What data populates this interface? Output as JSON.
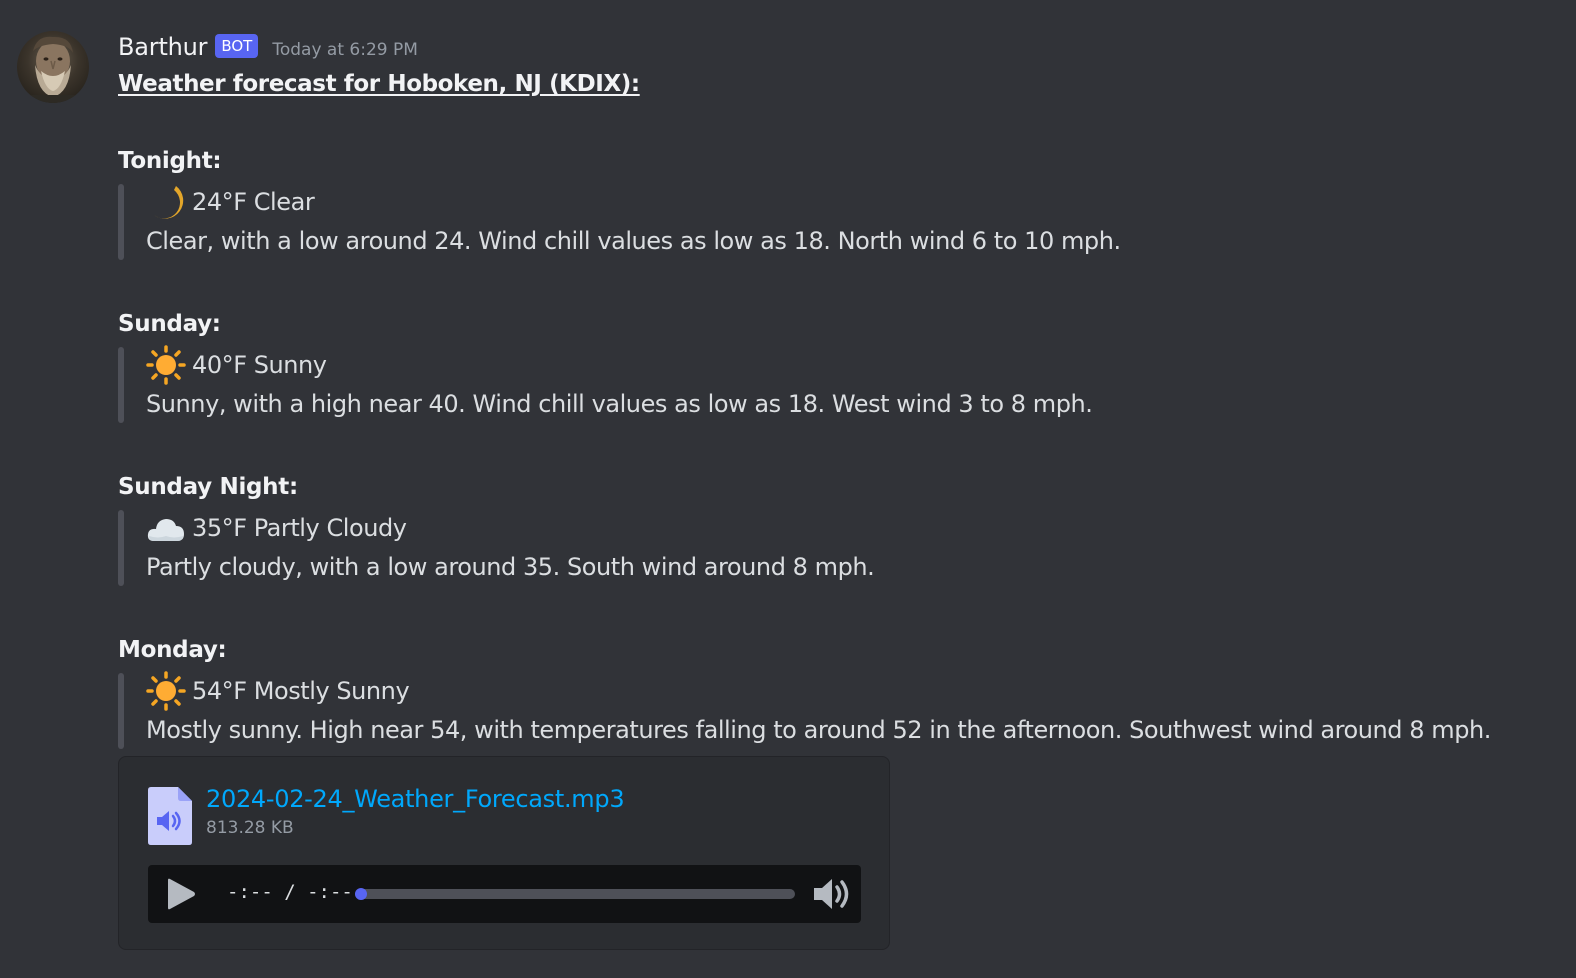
{
  "message": {
    "username": "Barthur",
    "bot_tag": "BOT",
    "timestamp": "Today at 6:29 PM",
    "title": "Weather forecast for Hoboken, NJ (KDIX):"
  },
  "forecast": [
    {
      "name": "Tonight:",
      "icon": "crescent-moon-icon",
      "summary": "24°F Clear",
      "detail": "Clear, with a low around 24. Wind chill values as low as 18. North wind 6 to 10 mph."
    },
    {
      "name": "Sunday:",
      "icon": "sun-icon",
      "summary": "40°F Sunny",
      "detail": "Sunny, with a high near 40. Wind chill values as low as 18. West wind 3 to 8 mph."
    },
    {
      "name": "Sunday Night:",
      "icon": "cloud-icon",
      "summary": "35°F Partly Cloudy",
      "detail": "Partly cloudy, with a low around 35. South wind around 8 mph."
    },
    {
      "name": "Monday:",
      "icon": "sun-icon",
      "summary": "54°F Mostly Sunny",
      "detail": "Mostly sunny. High near 54, with temperatures falling to around 52 in the afternoon. Southwest wind around 8 mph."
    }
  ],
  "attachment": {
    "file_icon": "audio-file-icon",
    "file_name": "2024-02-24_Weather_Forecast.mp3",
    "file_size": "813.28 KB",
    "player": {
      "play_icon": "play-icon",
      "time_text": "-:-- / -:--",
      "progress": 0,
      "volume_icon": "volume-icon"
    }
  },
  "colors": {
    "background": "#313338",
    "bot_tag": "#5865f2",
    "link": "#00a8fc",
    "quote_bar": "#4e5058",
    "progress": "#5865f2"
  }
}
